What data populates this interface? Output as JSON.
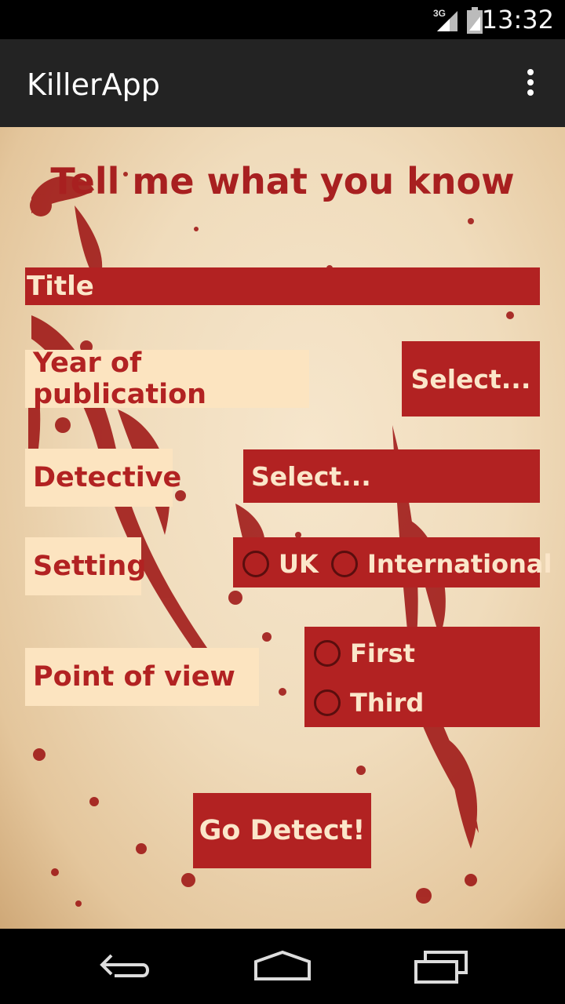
{
  "status_bar": {
    "network": "3G",
    "time": "13:32"
  },
  "action_bar": {
    "title": "KillerApp",
    "overflow_icon": "overflow-menu-icon"
  },
  "heading": "Tell me what you know",
  "form": {
    "title_placeholder": "Title",
    "year_label": "Year of publication",
    "year_button": "Select...",
    "detective_label": "Detective",
    "detective_select": "Select...",
    "setting_label": "Setting",
    "setting_options": [
      "UK",
      "International"
    ],
    "pov_label": "Point of view",
    "pov_options": [
      "First",
      "Third"
    ],
    "submit_button": "Go Detect!"
  },
  "colors": {
    "accent_red": "#b22222",
    "cream": "#fce4c0",
    "heading_red": "#a82020"
  },
  "nav_bar": {
    "icons": [
      "back-icon",
      "home-icon",
      "recent-apps-icon"
    ]
  }
}
